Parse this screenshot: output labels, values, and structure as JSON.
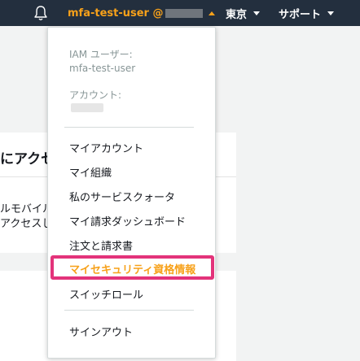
{
  "topbar": {
    "user_label": "mfa-test-user @",
    "region_label": "東京",
    "support_label": "サポート"
  },
  "background": {
    "heading": "にアクセ",
    "line1": "ルモバイル",
    "line2": "アクセスし"
  },
  "dropdown": {
    "iam_user_label": "IAM ユーザー:",
    "iam_user_value": "mfa-test-user",
    "account_label": "アカウント:",
    "items": [
      "マイアカウント",
      "マイ組織",
      "私のサービスクォータ",
      "マイ請求ダッシュボード",
      "注文と請求書",
      "マイセキュリティ資格情報",
      "スイッチロール"
    ],
    "signout": "サインアウト"
  },
  "colors": {
    "nav_bg": "#232f3e",
    "accent": "#f7a11a",
    "highlight": "#e3337a"
  },
  "icons": {
    "bell": "bell-icon",
    "caret_up": "caret-up-icon",
    "caret_down": "caret-down-icon"
  }
}
